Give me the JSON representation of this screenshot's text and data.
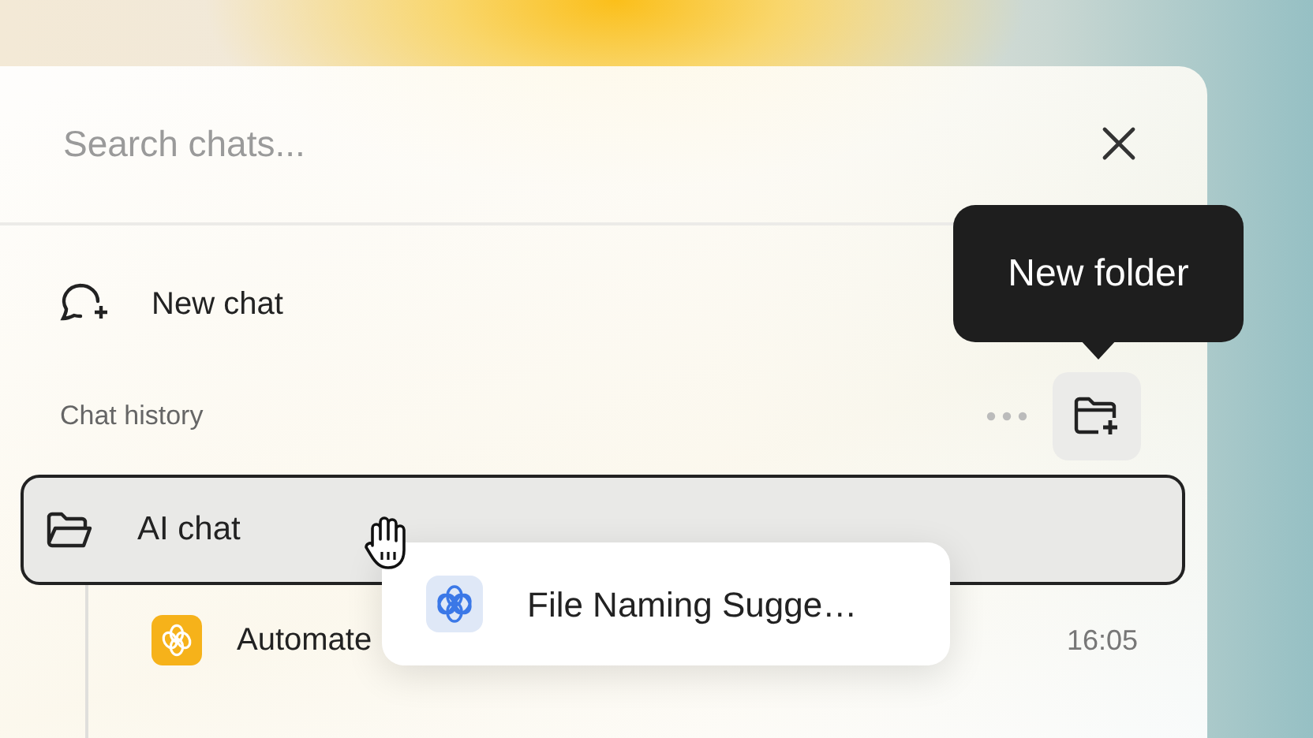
{
  "search": {
    "placeholder": "Search chats..."
  },
  "new_chat": {
    "label": "New chat"
  },
  "history": {
    "label": "Chat history"
  },
  "tooltip": {
    "text": "New folder"
  },
  "folders": [
    {
      "name": "AI chat",
      "selected": true,
      "children": [
        {
          "title": "Automate",
          "time": "16:05"
        }
      ]
    }
  ],
  "drag_card": {
    "title": "File Naming Sugge…"
  }
}
